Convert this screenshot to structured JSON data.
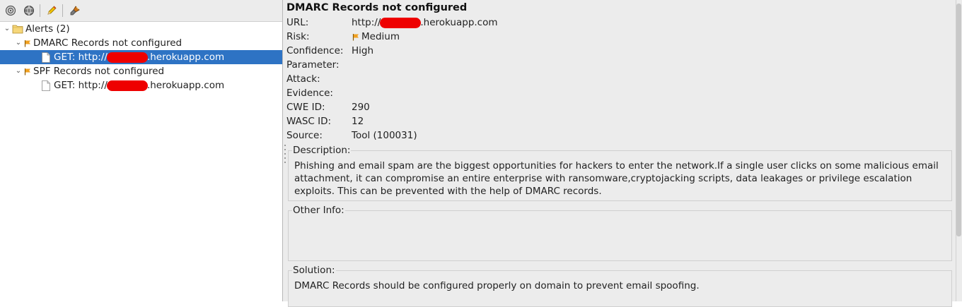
{
  "toolbar": {
    "icons": [
      "target-icon",
      "globe-icon",
      "pencil-icon",
      "brush-icon"
    ]
  },
  "tree": {
    "root": {
      "label": "Alerts (2)"
    },
    "alerts": [
      {
        "label": "DMARC Records not configured",
        "risk_color": "#f0a020",
        "children": [
          {
            "prefix": "GET: http://",
            "suffix": ".herokuapp.com",
            "selected": true
          }
        ]
      },
      {
        "label": "SPF Records not configured",
        "risk_color": "#f0a020",
        "children": [
          {
            "prefix": "GET: http://",
            "suffix": ".herokuapp.com",
            "selected": false
          }
        ]
      }
    ]
  },
  "detail": {
    "title": "DMARC Records not configured",
    "fields": {
      "url_label": "URL:",
      "url_prefix": "http://",
      "url_suffix": ".herokuapp.com",
      "risk_label": "Risk:",
      "risk_value": "Medium",
      "confidence_label": "Confidence:",
      "confidence_value": "High",
      "parameter_label": "Parameter:",
      "attack_label": "Attack:",
      "evidence_label": "Evidence:",
      "cwe_label": "CWE ID:",
      "cwe_value": "290",
      "wasc_label": "WASC ID:",
      "wasc_value": "12",
      "source_label": "Source:",
      "source_value": "Tool (100031)"
    },
    "description": {
      "label": "Description:",
      "text": "Phishing and email spam are the biggest opportunities for hackers to enter the network.If a single user clicks on some malicious email attachment, it can compromise an entire enterprise with ransomware,cryptojacking scripts, data leakages or privilege escalation exploits. This can be prevented with the help of DMARC records."
    },
    "other_info": {
      "label": "Other Info:",
      "text": ""
    },
    "solution": {
      "label": "Solution:",
      "text": "DMARC Records should be configured properly on domain to prevent email spoofing."
    }
  },
  "colors": {
    "selection": "#2e73c4",
    "redaction": "#ee0000",
    "risk_flag": "#f0a020"
  }
}
